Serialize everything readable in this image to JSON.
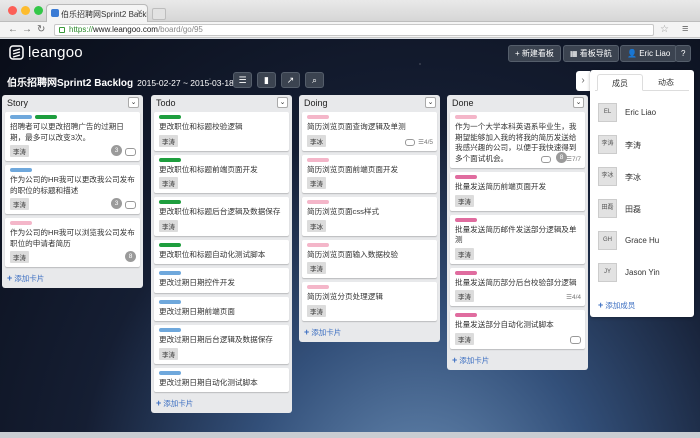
{
  "browser": {
    "tab_title": "伯乐招聘网Sprint2 Backlog",
    "url_https": "https://",
    "url_host": "www.leangoo.com",
    "url_path": "/board/go/95",
    "traffic_colors": [
      "#fc5f57",
      "#fdbc2e",
      "#33c748"
    ]
  },
  "app": {
    "logo": "leangoo",
    "new_board": "+ 新建看板",
    "board_nav": "看板导航",
    "user": "Eric Liao",
    "help": "?"
  },
  "board": {
    "title": "伯乐招聘网Sprint2 Backlog",
    "dates": "2015-02-27 ~ 2015-03-18"
  },
  "columns": [
    {
      "title": "Story",
      "add": "添加卡片",
      "cards": [
        {
          "labels": [
            "#6fa8dc",
            "#1e9e3e"
          ],
          "text": "招聘者可以更改招聘广告的过期日期，最多可以改变3次。",
          "tag": "李涛",
          "count": "3",
          "comment": true
        },
        {
          "labels": [
            "#6fa8dc"
          ],
          "text": "作为公司的HR我可以更改我公司发布的职位的标题和描述",
          "tag": "李涛",
          "count": "3",
          "comment": true
        },
        {
          "labels": [
            "#f4b6c9"
          ],
          "text": "作为公司的HR我可以浏览我公司发布职位的申请者简历",
          "tag": "李涛",
          "count": "8",
          "comment": false
        }
      ]
    },
    {
      "title": "Todo",
      "add": "添加卡片",
      "cards": [
        {
          "labels": [
            "#1e9e3e"
          ],
          "text": "更改职位和标题校验逻辑",
          "tag": "李涛"
        },
        {
          "labels": [
            "#1e9e3e"
          ],
          "text": "更改职位和标题前端页面开发",
          "tag": "李涛"
        },
        {
          "labels": [
            "#1e9e3e"
          ],
          "text": "更改职位和标题后台逻辑及数据保存",
          "tag": "李涛"
        },
        {
          "labels": [
            "#1e9e3e"
          ],
          "text": "更改职位和标题自动化测试脚本",
          "tag": ""
        },
        {
          "labels": [
            "#6fa8dc"
          ],
          "text": "更改过期日期控件开发",
          "tag": ""
        },
        {
          "labels": [
            "#6fa8dc"
          ],
          "text": "更改过期日期前端页面",
          "tag": ""
        },
        {
          "labels": [
            "#6fa8dc"
          ],
          "text": "更改过期日期后台逻辑及数据保存",
          "tag": "李涛"
        },
        {
          "labels": [
            "#6fa8dc"
          ],
          "text": "更改过期日期自动化测试脚本",
          "tag": ""
        }
      ]
    },
    {
      "title": "Doing",
      "add": "添加卡片",
      "cards": [
        {
          "labels": [
            "#f4b6c9"
          ],
          "text": "简历浏览页面查询逻辑及单测",
          "tag": "李冰",
          "check": "4/5",
          "comment": true
        },
        {
          "labels": [
            "#f4b6c9"
          ],
          "text": "简历浏览页面前端页面开发",
          "tag": "李涛"
        },
        {
          "labels": [
            "#f4b6c9"
          ],
          "text": "简历浏览页面css样式",
          "tag": "李冰"
        },
        {
          "labels": [
            "#f4b6c9"
          ],
          "text": "简历浏览页面输入数据校验",
          "tag": "李涛"
        },
        {
          "labels": [
            "#f4b6c9"
          ],
          "text": "简历浏览分页处理逻辑",
          "tag": "李涛"
        }
      ]
    },
    {
      "title": "Done",
      "add": "添加卡片",
      "cards": [
        {
          "labels": [
            "#f4b6c9"
          ],
          "text": "作为一个大学本科英语系毕业生，我期望能够加入我的将我的简历发送给我感兴趣的公司，以便于我快速得到多个面试机会。",
          "tag": "",
          "count": "8",
          "check": "7/7",
          "comment": true
        },
        {
          "labels": [
            "#e06c9f"
          ],
          "text": "批量发送简历前端页面开发",
          "tag": "李涛"
        },
        {
          "labels": [
            "#e06c9f"
          ],
          "text": "批量发送简历邮件发送部分逻辑及单测",
          "tag": "李涛"
        },
        {
          "labels": [
            "#e06c9f"
          ],
          "text": "批量发送简历部分后台校验部分逻辑",
          "tag": "李涛",
          "check": "4/4"
        },
        {
          "labels": [
            "#e06c9f"
          ],
          "text": "批量发送部分自动化测试脚本",
          "tag": "李涛",
          "comment": true
        }
      ]
    }
  ],
  "panel": {
    "tab_members": "成员",
    "tab_activity": "动态",
    "members": [
      {
        "avatar": "EL",
        "name": "Eric Liao"
      },
      {
        "avatar": "李涛",
        "name": "李涛"
      },
      {
        "avatar": "李冰",
        "name": "李冰"
      },
      {
        "avatar": "田磊",
        "name": "田磊"
      },
      {
        "avatar": "GH",
        "name": "Grace Hu"
      },
      {
        "avatar": "JY",
        "name": "Jason Yin"
      }
    ],
    "add_member": "添加成员"
  }
}
